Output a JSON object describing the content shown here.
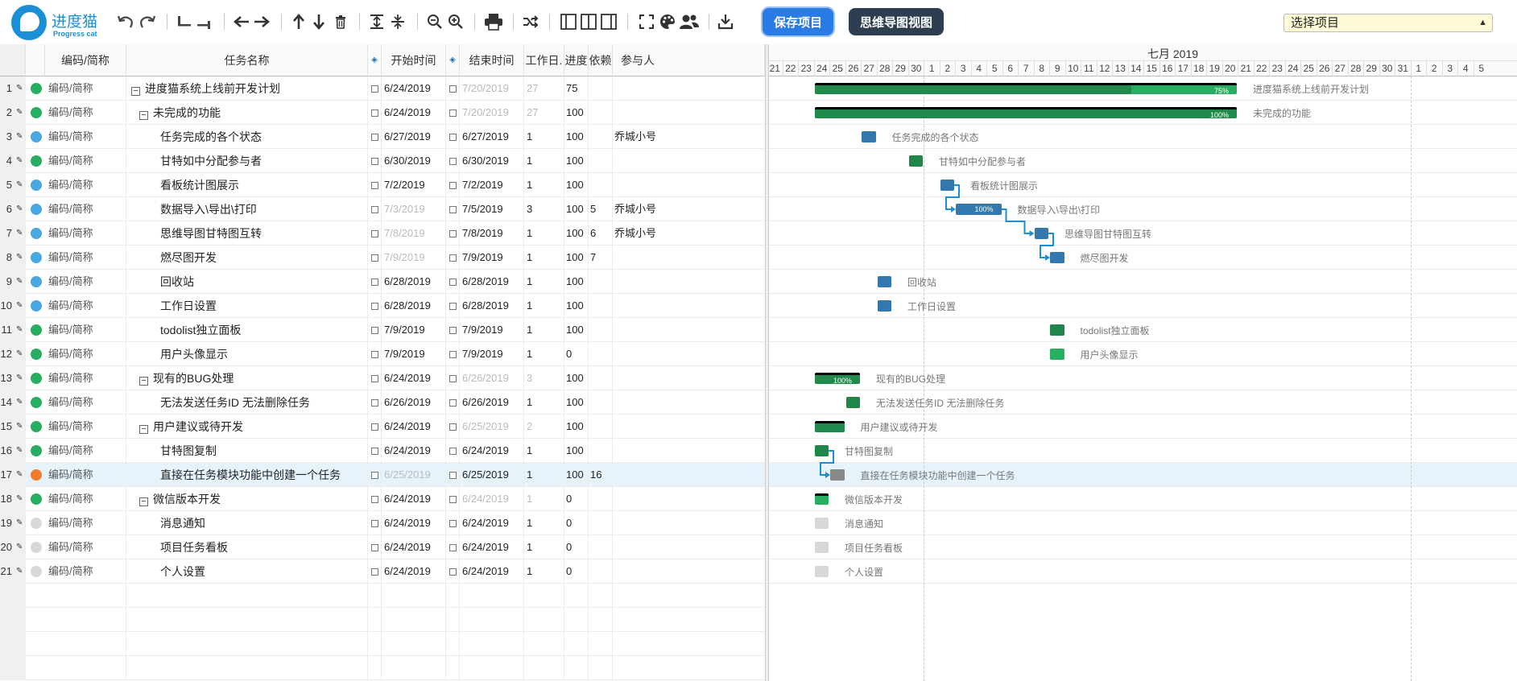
{
  "app": {
    "logo_cn": "进度猫",
    "logo_en": "Progress cat"
  },
  "toolbar": {
    "save_label": "保存项目",
    "mindmap_label": "思维导图视图",
    "project_select": "选择项目"
  },
  "columns": {
    "code": "编码/简称",
    "name": "任务名称",
    "start": "开始时间",
    "end": "结束时间",
    "duration": "工作日.",
    "progress": "进度",
    "depends": "依赖",
    "assignee": "参与人"
  },
  "tasks": [
    {
      "num": "1",
      "code": "编码/简称",
      "name": "进度猫系统上线前开发计划",
      "level": 0,
      "toggle": "−",
      "start": "6/24/2019",
      "end": "7/20/2019",
      "dur": "27",
      "prog": "75",
      "dep": "",
      "who": "",
      "status": "green",
      "start_dim": false,
      "end_dim": true,
      "dur_dim": true,
      "bar_label": "75%"
    },
    {
      "num": "2",
      "code": "编码/简称",
      "name": "未完成的功能",
      "level": 1,
      "toggle": "−",
      "start": "6/24/2019",
      "end": "7/20/2019",
      "dur": "27",
      "prog": "100",
      "dep": "",
      "who": "",
      "status": "green",
      "start_dim": false,
      "end_dim": true,
      "dur_dim": true,
      "bar_label": "100%"
    },
    {
      "num": "3",
      "code": "编码/简称",
      "name": "任务完成的各个状态",
      "level": 2,
      "toggle": "",
      "start": "6/27/2019",
      "end": "6/27/2019",
      "dur": "1",
      "prog": "100",
      "dep": "",
      "who": "乔城小号",
      "status": "blue",
      "start_dim": false,
      "end_dim": false,
      "dur_dim": false,
      "bar_label": ""
    },
    {
      "num": "4",
      "code": "编码/简称",
      "name": "甘特如中分配参与者",
      "level": 2,
      "toggle": "",
      "start": "6/30/2019",
      "end": "6/30/2019",
      "dur": "1",
      "prog": "100",
      "dep": "",
      "who": "",
      "status": "green",
      "start_dim": false,
      "end_dim": false,
      "dur_dim": false,
      "bar_label": ""
    },
    {
      "num": "5",
      "code": "编码/简称",
      "name": "看板统计图展示",
      "level": 2,
      "toggle": "",
      "start": "7/2/2019",
      "end": "7/2/2019",
      "dur": "1",
      "prog": "100",
      "dep": "",
      "who": "",
      "status": "blue",
      "start_dim": false,
      "end_dim": false,
      "dur_dim": false,
      "bar_label": ""
    },
    {
      "num": "6",
      "code": "编码/简称",
      "name": "数据导入\\导出\\打印",
      "level": 2,
      "toggle": "",
      "start": "7/3/2019",
      "end": "7/5/2019",
      "dur": "3",
      "prog": "100",
      "dep": "5",
      "who": "乔城小号",
      "status": "blue",
      "start_dim": true,
      "end_dim": false,
      "dur_dim": false,
      "bar_label": "100%"
    },
    {
      "num": "7",
      "code": "编码/简称",
      "name": "思维导图甘特图互转",
      "level": 2,
      "toggle": "",
      "start": "7/8/2019",
      "end": "7/8/2019",
      "dur": "1",
      "prog": "100",
      "dep": "6",
      "who": "乔城小号",
      "status": "blue",
      "start_dim": true,
      "end_dim": false,
      "dur_dim": false,
      "bar_label": ""
    },
    {
      "num": "8",
      "code": "编码/简称",
      "name": "燃尽图开发",
      "level": 2,
      "toggle": "",
      "start": "7/9/2019",
      "end": "7/9/2019",
      "dur": "1",
      "prog": "100",
      "dep": "7",
      "who": "",
      "status": "blue",
      "start_dim": true,
      "end_dim": false,
      "dur_dim": false,
      "bar_label": ""
    },
    {
      "num": "9",
      "code": "编码/简称",
      "name": "回收站",
      "level": 2,
      "toggle": "",
      "start": "6/28/2019",
      "end": "6/28/2019",
      "dur": "1",
      "prog": "100",
      "dep": "",
      "who": "",
      "status": "blue",
      "start_dim": false,
      "end_dim": false,
      "dur_dim": false,
      "bar_label": ""
    },
    {
      "num": "10",
      "code": "编码/简称",
      "name": "工作日设置",
      "level": 2,
      "toggle": "",
      "start": "6/28/2019",
      "end": "6/28/2019",
      "dur": "1",
      "prog": "100",
      "dep": "",
      "who": "",
      "status": "blue",
      "start_dim": false,
      "end_dim": false,
      "dur_dim": false,
      "bar_label": ""
    },
    {
      "num": "11",
      "code": "编码/简称",
      "name": "todolist独立面板",
      "level": 2,
      "toggle": "",
      "start": "7/9/2019",
      "end": "7/9/2019",
      "dur": "1",
      "prog": "100",
      "dep": "",
      "who": "",
      "status": "green",
      "start_dim": false,
      "end_dim": false,
      "dur_dim": false,
      "bar_label": ""
    },
    {
      "num": "12",
      "code": "编码/简称",
      "name": "用户头像显示",
      "level": 2,
      "toggle": "",
      "start": "7/9/2019",
      "end": "7/9/2019",
      "dur": "1",
      "prog": "0",
      "dep": "",
      "who": "",
      "status": "green",
      "start_dim": false,
      "end_dim": false,
      "dur_dim": false,
      "bar_label": ""
    },
    {
      "num": "13",
      "code": "编码/简称",
      "name": "现有的BUG处理",
      "level": 1,
      "toggle": "−",
      "start": "6/24/2019",
      "end": "6/26/2019",
      "dur": "3",
      "prog": "100",
      "dep": "",
      "who": "",
      "status": "green",
      "start_dim": false,
      "end_dim": true,
      "dur_dim": true,
      "bar_label": "100%"
    },
    {
      "num": "14",
      "code": "编码/简称",
      "name": "无法发送任务ID 无法删除任务",
      "level": 2,
      "toggle": "",
      "start": "6/26/2019",
      "end": "6/26/2019",
      "dur": "1",
      "prog": "100",
      "dep": "",
      "who": "",
      "status": "green",
      "start_dim": false,
      "end_dim": false,
      "dur_dim": false,
      "bar_label": ""
    },
    {
      "num": "15",
      "code": "编码/简称",
      "name": "用户建议或待开发",
      "level": 1,
      "toggle": "−",
      "start": "6/24/2019",
      "end": "6/25/2019",
      "dur": "2",
      "prog": "100",
      "dep": "",
      "who": "",
      "status": "green",
      "start_dim": false,
      "end_dim": true,
      "dur_dim": true,
      "bar_label": ""
    },
    {
      "num": "16",
      "code": "编码/简称",
      "name": "甘特图复制",
      "level": 2,
      "toggle": "",
      "start": "6/24/2019",
      "end": "6/24/2019",
      "dur": "1",
      "prog": "100",
      "dep": "",
      "who": "",
      "status": "green",
      "start_dim": false,
      "end_dim": false,
      "dur_dim": false,
      "bar_label": ""
    },
    {
      "num": "17",
      "code": "编码/简称",
      "name": "直接在任务模块功能中创建一个任务",
      "level": 2,
      "toggle": "",
      "start": "6/25/2019",
      "end": "6/25/2019",
      "dur": "1",
      "prog": "100",
      "dep": "16",
      "who": "",
      "status": "orange",
      "start_dim": true,
      "end_dim": false,
      "dur_dim": false,
      "bar_label": ""
    },
    {
      "num": "18",
      "code": "编码/简称",
      "name": "微信版本开发",
      "level": 1,
      "toggle": "−",
      "start": "6/24/2019",
      "end": "6/24/2019",
      "dur": "1",
      "prog": "0",
      "dep": "",
      "who": "",
      "status": "green",
      "start_dim": false,
      "end_dim": true,
      "dur_dim": true,
      "bar_label": ""
    },
    {
      "num": "19",
      "code": "编码/简称",
      "name": "消息通知",
      "level": 2,
      "toggle": "",
      "start": "6/24/2019",
      "end": "6/24/2019",
      "dur": "1",
      "prog": "0",
      "dep": "",
      "who": "",
      "status": "gray",
      "start_dim": false,
      "end_dim": false,
      "dur_dim": false,
      "bar_label": ""
    },
    {
      "num": "20",
      "code": "编码/简称",
      "name": "项目任务看板",
      "level": 2,
      "toggle": "",
      "start": "6/24/2019",
      "end": "6/24/2019",
      "dur": "1",
      "prog": "0",
      "dep": "",
      "who": "",
      "status": "gray",
      "start_dim": false,
      "end_dim": false,
      "dur_dim": false,
      "bar_label": ""
    },
    {
      "num": "21",
      "code": "编码/简称",
      "name": "个人设置",
      "level": 2,
      "toggle": "",
      "start": "6/24/2019",
      "end": "6/24/2019",
      "dur": "1",
      "prog": "0",
      "dep": "",
      "who": "",
      "status": "gray",
      "start_dim": false,
      "end_dim": false,
      "dur_dim": false,
      "bar_label": ""
    }
  ],
  "selected_row": "17",
  "gantt": {
    "month_label": "七月 2019",
    "days": [
      "21",
      "22",
      "23",
      "24",
      "25",
      "26",
      "27",
      "28",
      "29",
      "30",
      "1",
      "2",
      "3",
      "4",
      "5",
      "6",
      "7",
      "8",
      "9",
      "10",
      "11",
      "12",
      "13",
      "14",
      "15",
      "16",
      "17",
      "18",
      "19",
      "20",
      "21",
      "22",
      "23",
      "24",
      "25",
      "26",
      "27",
      "28",
      "29",
      "30",
      "31",
      "1",
      "2",
      "3",
      "4",
      "5"
    ]
  },
  "colors": {
    "green": "#27ae60",
    "green_dark": "#1e7e44",
    "blue": "#4aa8e0",
    "blue_dark": "#2e6fa3",
    "orange": "#f07d2c",
    "gray": "#d8d8d8",
    "brand": "#1a8fd6",
    "selected_row": "#e6f3fb"
  }
}
